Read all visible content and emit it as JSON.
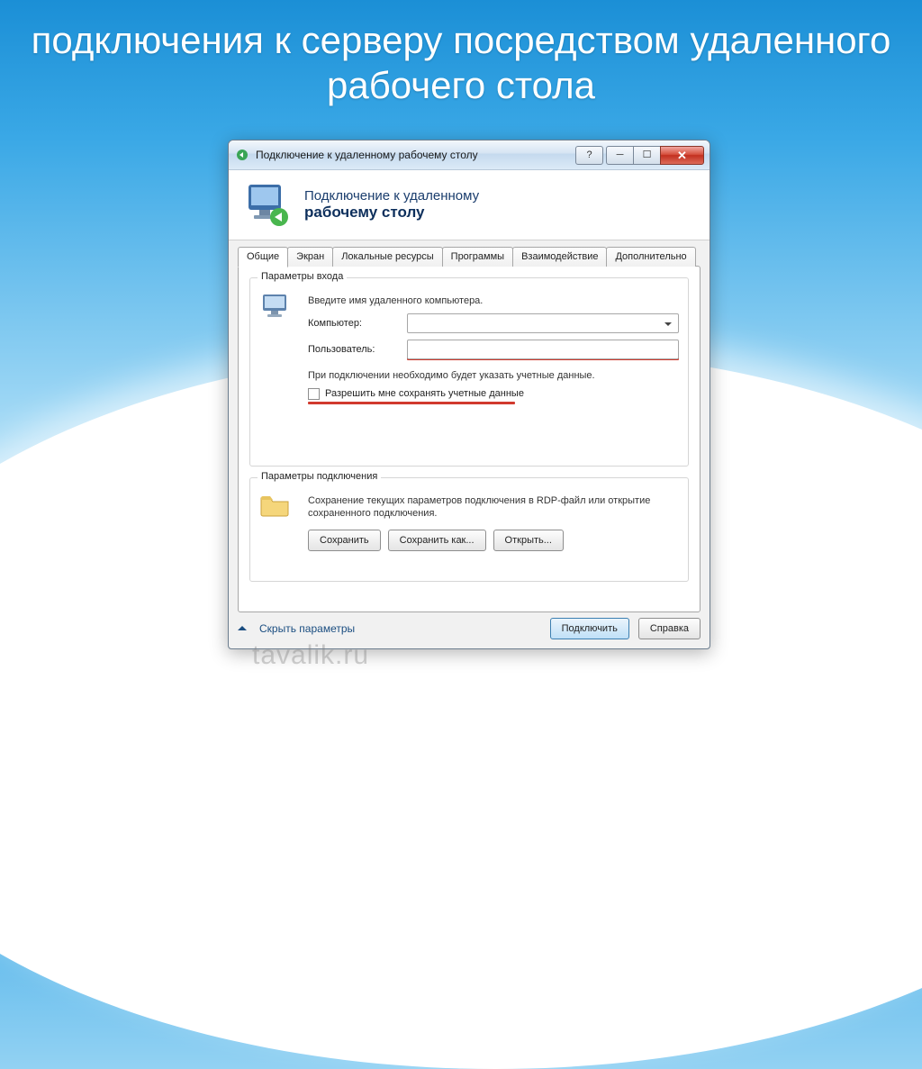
{
  "slide": {
    "title": "подключения к серверу посредством удаленного рабочего стола"
  },
  "window": {
    "title": "Подключение к удаленному рабочему столу",
    "header": {
      "line1": "Подключение к удаленному",
      "line2": "рабочему столу"
    },
    "tabs": [
      "Общие",
      "Экран",
      "Локальные ресурсы",
      "Программы",
      "Взаимодействие",
      "Дополнительно"
    ],
    "active_tab_index": 0,
    "group_login": {
      "legend": "Параметры входа",
      "prompt": "Введите имя удаленного компьютера.",
      "computer_label": "Компьютер:",
      "user_label": "Пользователь:",
      "note": "При подключении необходимо будет указать учетные данные.",
      "checkbox_label": "Разрешить мне сохранять учетные данные"
    },
    "group_conn": {
      "legend": "Параметры подключения",
      "note": "Сохранение текущих параметров подключения в RDP-файл или открытие сохраненного подключения.",
      "btn_save": "Сохранить",
      "btn_saveas": "Сохранить как...",
      "btn_open": "Открыть..."
    },
    "footer": {
      "hide_link": "Скрыть параметры",
      "connect": "Подключить",
      "help": "Справка"
    }
  },
  "watermark": "tavalik.ru"
}
